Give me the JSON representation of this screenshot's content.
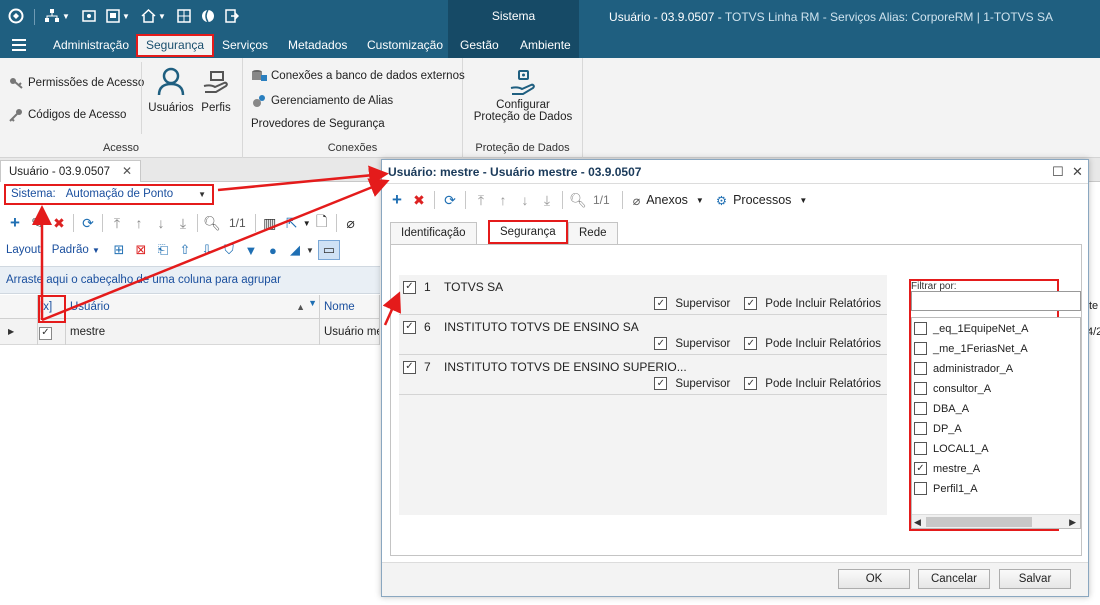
{
  "titlebar": {
    "system_label": "Sistema",
    "app_title_main": "Usuário - 03.9.0507 -",
    "app_title_rest": "TOTVS Linha RM - Serviços  Alias: CorporeRM | 1-TOTVS SA"
  },
  "menu": {
    "items": [
      "Administração",
      "Segurança",
      "Serviços",
      "Metadados",
      "Customização",
      "Gestão",
      "Ambiente"
    ]
  },
  "ribbon": {
    "acesso": {
      "title": "Acesso",
      "permissoes": "Permissões de Acesso",
      "codigos": "Códigos de Acesso",
      "usuarios": "Usuários",
      "perfis": "Perfis"
    },
    "conexoes": {
      "title": "Conexões",
      "bancos": "Conexões a banco de dados externos",
      "alias": "Gerenciamento de Alias",
      "provedores": "Provedores de Segurança"
    },
    "protecao": {
      "title": "Proteção de Dados",
      "configurar_1": "Configurar",
      "configurar_2": "Proteção de Dados"
    }
  },
  "window": {
    "tab_title": "Usuário - 03.9.0507",
    "sistema_label": "Sistema:",
    "sistema_value": "Automação de Ponto",
    "pager": "1/1",
    "layout_label": "Layout:",
    "layout_value": "Padrão",
    "group_hint": "Arraste aqui o cabeçalho de uma coluna para agrupar",
    "grid": {
      "columns": [
        "[x]",
        "Usuário",
        "Nome"
      ],
      "rows": [
        {
          "usuario": "mestre",
          "nome": "Usuário me"
        }
      ]
    },
    "right_strip_1": "te",
    "right_strip_2": "4/2"
  },
  "dialog": {
    "title": "Usuário: mestre - Usuário mestre - 03.9.0507",
    "pager": "1/1",
    "anexos": "Anexos",
    "processos": "Processos",
    "tabs": [
      "Identificação",
      "Segurança",
      "Rede"
    ],
    "entries": [
      {
        "code": "1",
        "name": "TOTVS SA",
        "supervisor": "Supervisor",
        "relatorios": "Pode Incluir Relatórios"
      },
      {
        "code": "6",
        "name": "INSTITUTO TOTVS DE ENSINO SA",
        "supervisor": "Supervisor",
        "relatorios": "Pode Incluir Relatórios"
      },
      {
        "code": "7",
        "name": "INSTITUTO TOTVS DE ENSINO SUPERIO...",
        "supervisor": "Supervisor",
        "relatorios": "Pode Incluir Relatórios"
      }
    ],
    "filter": {
      "label": "Filtrar por:",
      "items": [
        {
          "name": "_eq_1EquipeNet_A",
          "checked": false
        },
        {
          "name": "_me_1FeriasNet_A",
          "checked": false
        },
        {
          "name": "administrador_A",
          "checked": false
        },
        {
          "name": "consultor_A",
          "checked": false
        },
        {
          "name": "DBA_A",
          "checked": false
        },
        {
          "name": "DP_A",
          "checked": false
        },
        {
          "name": "LOCAL1_A",
          "checked": false
        },
        {
          "name": "mestre_A",
          "checked": true
        },
        {
          "name": "Perfil1_A",
          "checked": false
        }
      ]
    },
    "buttons": {
      "ok": "OK",
      "cancel": "Cancelar",
      "save": "Salvar"
    }
  },
  "colors": {
    "brand": "#1f5f80",
    "highlight": "#e41b1b",
    "link": "#1a4f9e"
  }
}
